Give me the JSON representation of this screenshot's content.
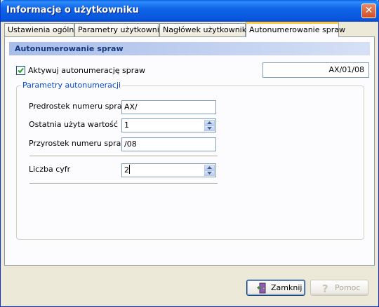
{
  "window": {
    "title": "Informacje o użytkowniku",
    "close_glyph": "✕"
  },
  "tabs": [
    {
      "label": "Ustawienia ogólne"
    },
    {
      "label": "Parametry użytkownika"
    },
    {
      "label": "Nagłówek użytkownika"
    },
    {
      "label": "Autonumerowanie spraw",
      "active": true
    }
  ],
  "section": {
    "title": "Autonumerowanie spraw"
  },
  "activate": {
    "label": "Aktywuj autonumerację spraw",
    "checked": true
  },
  "preview": {
    "value": "AX/01/08"
  },
  "group": {
    "title": "Parametry autonumeracji",
    "fields": [
      {
        "label": "Predrostek numeru spraw",
        "value": "AX/"
      },
      {
        "label": "Ostatnia użyta wartość",
        "value": "1"
      },
      {
        "label": "Przyrostek numeru sprawy",
        "value": "/08"
      },
      {
        "label": "Liczba cyfr",
        "value": "2"
      }
    ]
  },
  "buttons": {
    "close": {
      "label": "Zamknij",
      "icon": "door-exit-icon"
    },
    "help": {
      "label": "Pomoc",
      "icon": "help-question-icon"
    }
  },
  "colors": {
    "title_bar": "#0855dd",
    "accent_tab": "#ffc83c",
    "group_title": "#0046d5"
  }
}
